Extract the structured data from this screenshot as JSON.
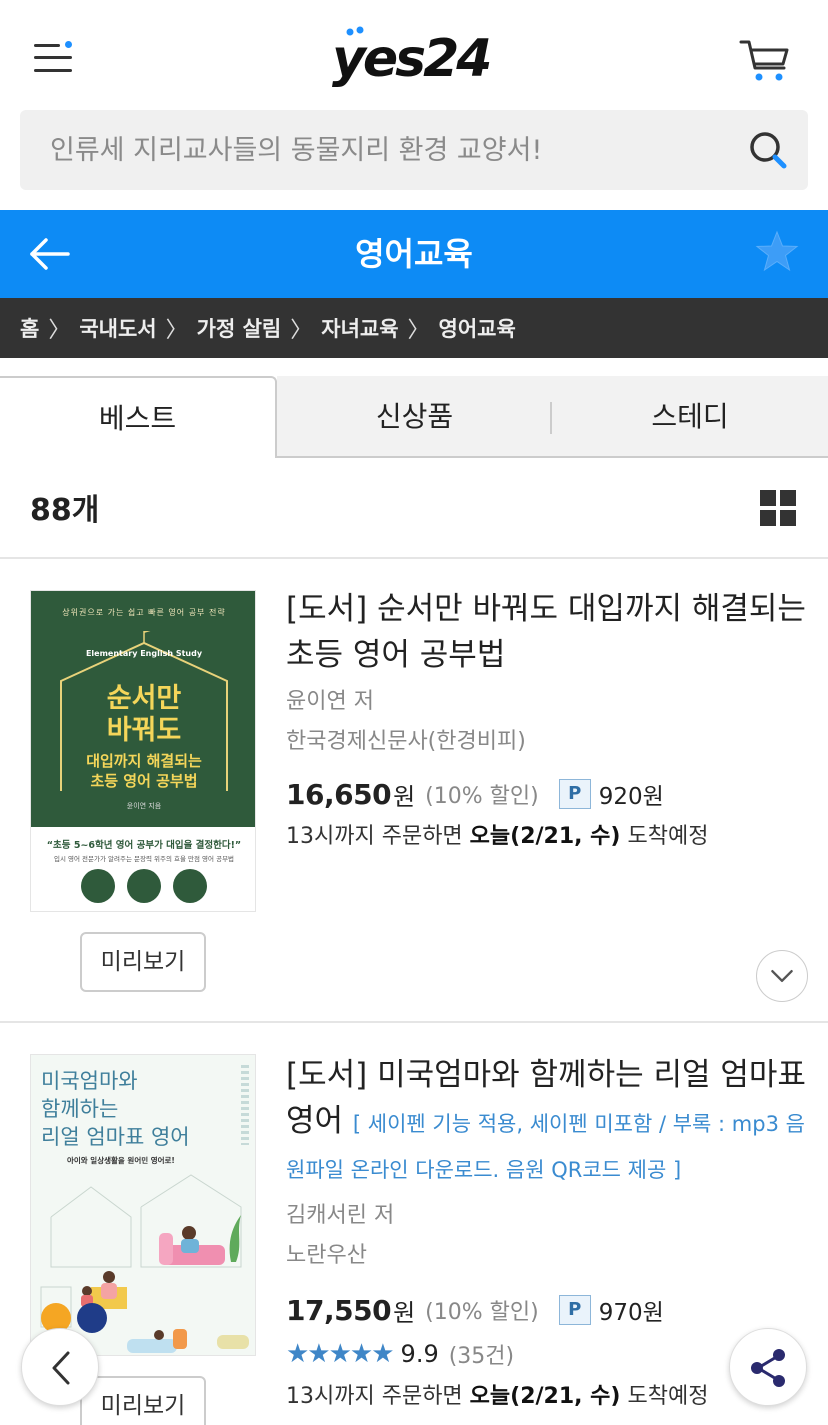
{
  "header": {
    "logo_text": "yes24",
    "menu_icon": "hamburger-menu-icon",
    "cart_icon": "cart-icon"
  },
  "search": {
    "placeholder": "인류세 지리교사들의 동물지리 환경 교양서!",
    "icon": "search-icon"
  },
  "titlebar": {
    "title": "영어교육",
    "back_icon": "back-arrow-icon",
    "favorite_icon": "star-icon",
    "color": "#0d8bf5"
  },
  "breadcrumb": [
    "홈",
    "국내도서",
    "가정 살림",
    "자녀교육",
    "영어교육"
  ],
  "tabs": [
    {
      "label": "베스트",
      "active": true
    },
    {
      "label": "신상품",
      "active": false
    },
    {
      "label": "스테디",
      "active": false
    }
  ],
  "list": {
    "count": "88개",
    "view_icon": "grid-view-icon"
  },
  "books": [
    {
      "title": "[도서] 순서만 바꿔도 대입까지 해결되는 초등 영어 공부법",
      "author": "윤이연 저",
      "publisher": "한국경제신문사(한경비피)",
      "price": "16,650",
      "price_unit": "원",
      "discount": "(10% 할인)",
      "point_badge": "P",
      "point": "920원",
      "delivery_prefix": "13시까지 주문하면",
      "delivery_date": "오늘(2/21, 수)",
      "delivery_suffix": "도착예정",
      "preview_label": "미리보기",
      "cover": {
        "top_line": "상위권으로 가는 쉽고 빠른 영어 공부 전략",
        "sub_en": "Elementary English Study",
        "main_title_1": "순서만",
        "main_title_2": "바꿔도",
        "sub_title_1": "대입까지 해결되는",
        "sub_title_2": "초등 영어 공부법",
        "author": "윤이연 지음",
        "quote": "“초등 5~6학년 영어 공부가 대입을 결정한다!”",
        "quote2": "입시 영어 전문가가 알려주는 문장력 위주의 효율 만점 영어 공부법"
      }
    },
    {
      "title": "[도서] 미국엄마와 함께하는 리얼 엄마표 영어",
      "title_extra": "[ 세이펜 기능 적용, 세이펜 미포함 / 부록 : mp3 음원파일 온라인 다운로드. 음원 QR코드 제공 ]",
      "author": "김캐서린 저",
      "publisher": "노란우산",
      "price": "17,550",
      "price_unit": "원",
      "discount": "(10% 할인)",
      "point_badge": "P",
      "point": "970원",
      "rating_stars": "★★★★★",
      "rating": "9.9",
      "reviews": "(35건)",
      "delivery_prefix": "13시까지 주문하면",
      "delivery_date": "오늘(2/21, 수)",
      "delivery_suffix": "도착예정",
      "preview_label": "미리보기",
      "cover": {
        "title_1": "미국엄마와",
        "title_2": "함께하는",
        "title_3": "리얼 엄마표 영어",
        "tagline": "아이와 일상생활을 원어민 영어로!"
      }
    }
  ],
  "floating": {
    "back_icon": "chevron-left-icon",
    "share_icon": "share-icon"
  }
}
